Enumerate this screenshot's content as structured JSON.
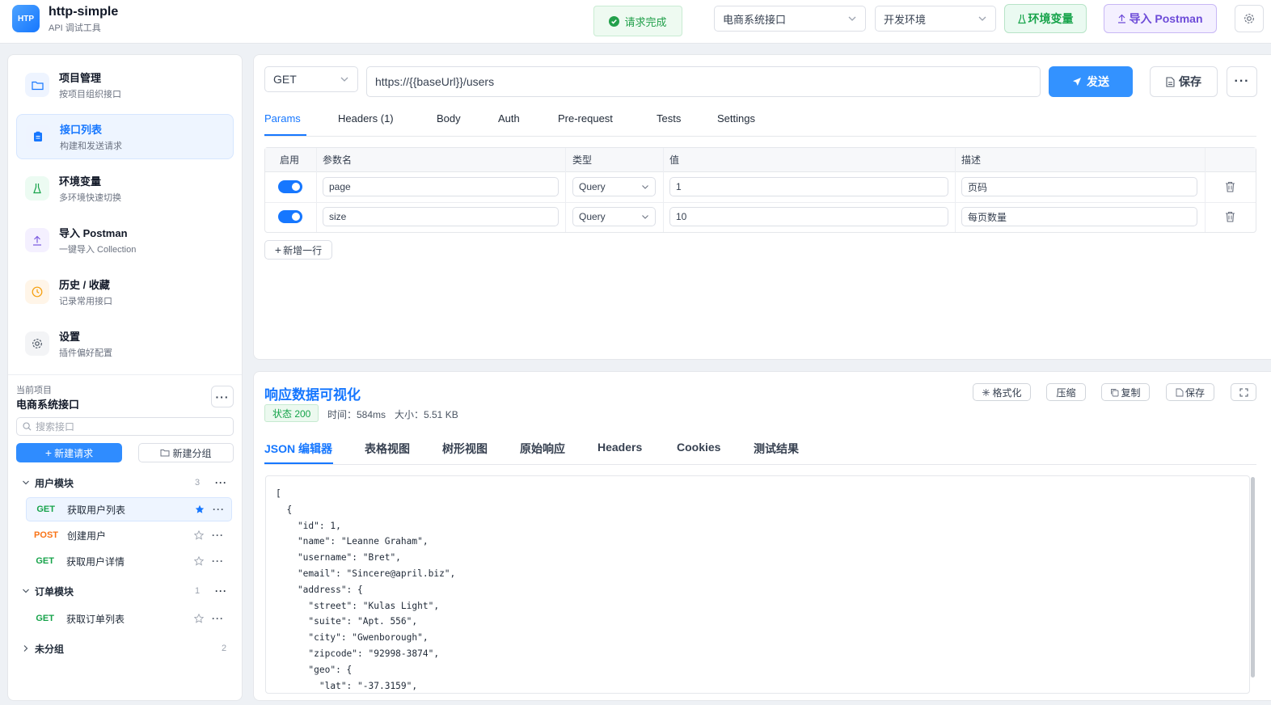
{
  "header": {
    "logo_text": "HTP",
    "app_title": "http-simple",
    "app_subtitle": "API 调试工具",
    "toast": "请求完成",
    "project_select": "电商系统接口",
    "env_select": "开发环境",
    "env_button": "环境变量",
    "import_button": "导入 Postman"
  },
  "sidebar": {
    "nav": [
      {
        "title": "项目管理",
        "sub": "按项目组织接口"
      },
      {
        "title": "接口列表",
        "sub": "构建和发送请求"
      },
      {
        "title": "环境变量",
        "sub": "多环境快速切换"
      },
      {
        "title": "导入 Postman",
        "sub": "一键导入 Collection"
      },
      {
        "title": "历史 / 收藏",
        "sub": "记录常用接口"
      },
      {
        "title": "设置",
        "sub": "插件偏好配置"
      }
    ],
    "current_project_label": "当前项目",
    "current_project": "电商系统接口",
    "search_placeholder": "搜索接口",
    "new_request": "新建请求",
    "new_group": "新建分组",
    "groups": [
      {
        "name": "用户模块",
        "count": "3"
      },
      {
        "name": "订单模块",
        "count": "1"
      },
      {
        "name": "未分组",
        "count": "2"
      }
    ],
    "requests": [
      {
        "method": "GET",
        "name": "获取用户列表"
      },
      {
        "method": "POST",
        "name": "创建用户"
      },
      {
        "method": "GET",
        "name": "获取用户详情"
      },
      {
        "method": "GET",
        "name": "获取订单列表"
      }
    ]
  },
  "request": {
    "method": "GET",
    "url": "https://{{baseUrl}}/users",
    "send": "发送",
    "save": "保存",
    "tabs": [
      "Params",
      "Headers (1)",
      "Body",
      "Auth",
      "Pre-request",
      "Tests",
      "Settings"
    ],
    "columns": [
      "启用",
      "参数名",
      "类型",
      "值",
      "描述"
    ],
    "rows": [
      {
        "name": "page",
        "type": "Query",
        "value": "1",
        "desc": "页码"
      },
      {
        "name": "size",
        "type": "Query",
        "value": "10",
        "desc": "每页数量"
      }
    ],
    "add_row": "新增一行"
  },
  "response": {
    "title": "响应数据可视化",
    "status": "状态 200",
    "time": "时间：584ms",
    "size": "大小：5.51 KB",
    "buttons": {
      "format": "格式化",
      "compress": "压缩",
      "copy": "复制",
      "save": "保存"
    },
    "tabs": [
      "JSON 编辑器",
      "表格视图",
      "树形视图",
      "原始响应",
      "Headers",
      "Cookies",
      "测试结果"
    ],
    "json_text": "[\n  {\n    \"id\": 1,\n    \"name\": \"Leanne Graham\",\n    \"username\": \"Bret\",\n    \"email\": \"Sincere@april.biz\",\n    \"address\": {\n      \"street\": \"Kulas Light\",\n      \"suite\": \"Apt. 556\",\n      \"city\": \"Gwenborough\",\n      \"zipcode\": \"92998-3874\",\n      \"geo\": {\n        \"lat\": \"-37.3159\","
  },
  "colors": {
    "accent": "#1677ff",
    "success": "#22a04b",
    "post": "#f97316",
    "get": "#16a34a"
  }
}
